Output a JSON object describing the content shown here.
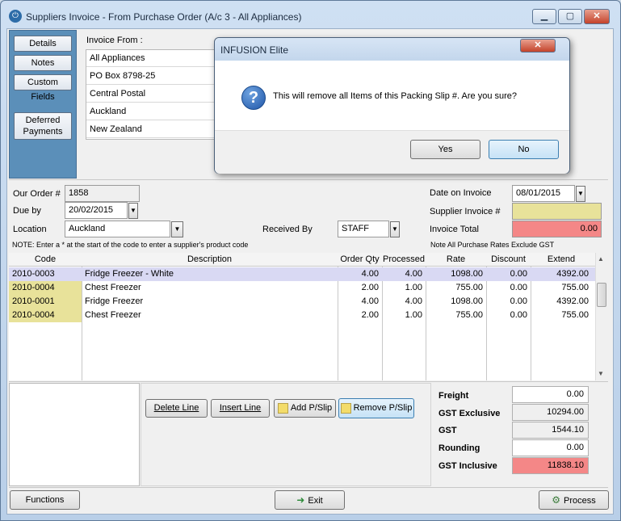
{
  "window": {
    "title": "Suppliers Invoice - From Purchase Order (A/c 3 - All Appliances)",
    "app_icon": "power-icon",
    "min_icon": "minimize-icon",
    "max_icon": "maximize-icon",
    "close_icon": "close-icon"
  },
  "side_buttons": {
    "details": "Details",
    "notes": "Notes",
    "custom_fields": "Custom Fields",
    "deferred_1": "Deferred",
    "deferred_2": "Payments"
  },
  "invoice_from": {
    "label": "Invoice From  :",
    "lines": [
      "All Appliances",
      "PO Box 8798-25",
      "Central Postal",
      "Auckland",
      "New Zealand"
    ]
  },
  "order": {
    "our_order_label": "Our Order #",
    "our_order_value": "1858",
    "due_by_label": "Due by",
    "due_by_value": "20/02/2015",
    "location_label": "Location",
    "location_value": "Auckland",
    "received_by_label": "Received By",
    "received_by_value": "STAFF",
    "date_on_invoice_label": "Date on Invoice",
    "date_on_invoice_value": "08/01/2015",
    "supplier_invoice_label": "Supplier Invoice #",
    "supplier_invoice_value": "",
    "invoice_total_label": "Invoice Total",
    "invoice_total_value": "0.00",
    "note_left": "NOTE: Enter a * at the start of the code to enter a supplier's product code",
    "note_right": "Note All Purchase Rates Exclude GST"
  },
  "grid": {
    "columns": [
      "Code",
      "Description",
      "Order Qty",
      "Processed",
      "Rate",
      "Discount",
      "Extend"
    ],
    "rows": [
      {
        "code": "2010-0003",
        "desc": "Fridge Freezer - White",
        "qty": "4.00",
        "processed": "4.00",
        "rate": "1098.00",
        "discount": "0.00",
        "extend": "4392.00"
      },
      {
        "code": "2010-0004",
        "desc": "Chest Freezer",
        "qty": "2.00",
        "processed": "1.00",
        "rate": "755.00",
        "discount": "0.00",
        "extend": "755.00"
      },
      {
        "code": "2010-0001",
        "desc": "Fridge Freezer",
        "qty": "4.00",
        "processed": "4.00",
        "rate": "1098.00",
        "discount": "0.00",
        "extend": "4392.00"
      },
      {
        "code": "2010-0004",
        "desc": "Chest Freezer",
        "qty": "2.00",
        "processed": "1.00",
        "rate": "755.00",
        "discount": "0.00",
        "extend": "755.00"
      }
    ]
  },
  "actions": {
    "delete_line": "Delete Line",
    "insert_line": "Insert Line",
    "add_pslip": "Add P/Slip",
    "remove_pslip": "Remove P/Slip"
  },
  "totals": {
    "freight_label": "Freight",
    "freight_value": "0.00",
    "gst_excl_label": "GST Exclusive",
    "gst_excl_value": "10294.00",
    "gst_label": "GST",
    "gst_value": "1544.10",
    "rounding_label": "Rounding",
    "rounding_value": "0.00",
    "gst_incl_label": "GST Inclusive",
    "gst_incl_value": "11838.10"
  },
  "footer": {
    "functions": "Functions",
    "exit": "Exit",
    "process": "Process"
  },
  "dialog": {
    "title": "INFUSION Elite",
    "message": "This will remove all Items of this Packing Slip #. Are you sure?",
    "yes": "Yes",
    "no": "No",
    "icon": "question-icon"
  },
  "colors": {
    "highlight_yellow": "#e8e29a",
    "highlight_red": "#f48787",
    "selected_row": "#d9d9f3",
    "side_blue": "#5b8fb9"
  }
}
